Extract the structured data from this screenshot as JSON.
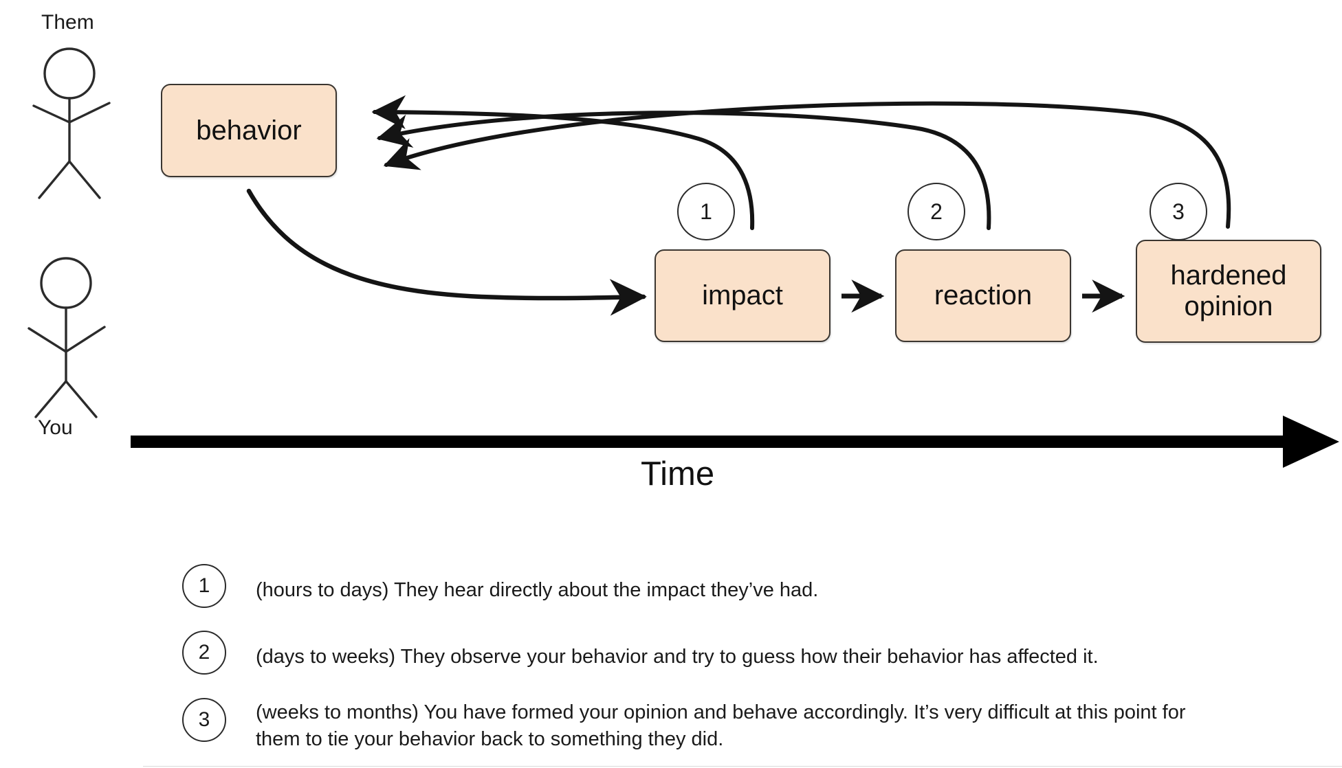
{
  "diagram": {
    "title_axis_label": "Time",
    "actors": [
      {
        "id": "them",
        "label": "Them",
        "label_position": "above"
      },
      {
        "id": "you",
        "label": "You",
        "label_position": "below"
      }
    ],
    "nodes": [
      {
        "id": "behavior",
        "label": "behavior",
        "lane": "them"
      },
      {
        "id": "impact",
        "label": "impact",
        "lane": "you"
      },
      {
        "id": "reaction",
        "label": "reaction",
        "lane": "you"
      },
      {
        "id": "hardened_opinion",
        "label_line1": "hardened",
        "label_line2": "opinion",
        "lane": "you"
      }
    ],
    "flow_edges": [
      {
        "from": "behavior",
        "to": "impact",
        "style": "curved"
      },
      {
        "from": "impact",
        "to": "reaction",
        "style": "straight"
      },
      {
        "from": "reaction",
        "to": "hardened_opinion",
        "style": "straight"
      }
    ],
    "feedback_edges": [
      {
        "id": "fb1",
        "marker": "1",
        "from": "impact",
        "to": "behavior"
      },
      {
        "id": "fb2",
        "marker": "2",
        "from": "reaction",
        "to": "behavior"
      },
      {
        "id": "fb3",
        "marker": "3",
        "from": "hardened_opinion",
        "to": "behavior"
      }
    ],
    "markers": [
      {
        "number": "1"
      },
      {
        "number": "2"
      },
      {
        "number": "3"
      }
    ],
    "colors": {
      "node_fill": "#FAE1CA",
      "node_stroke": "#3A3530",
      "line": "#1A1A1A",
      "background": "#FFFFFF"
    }
  },
  "legend": {
    "items": [
      {
        "number": "1",
        "text": " (hours to days) They hear directly about the impact they’ve had."
      },
      {
        "number": "2",
        "text": "(days to weeks) They observe your behavior and try to guess how their behavior has affected it."
      },
      {
        "number": "3",
        "text": "(weeks to months) You have formed your opinion and behave accordingly. It’s very difficult at this point for them to tie your behavior back to something they did."
      }
    ]
  }
}
